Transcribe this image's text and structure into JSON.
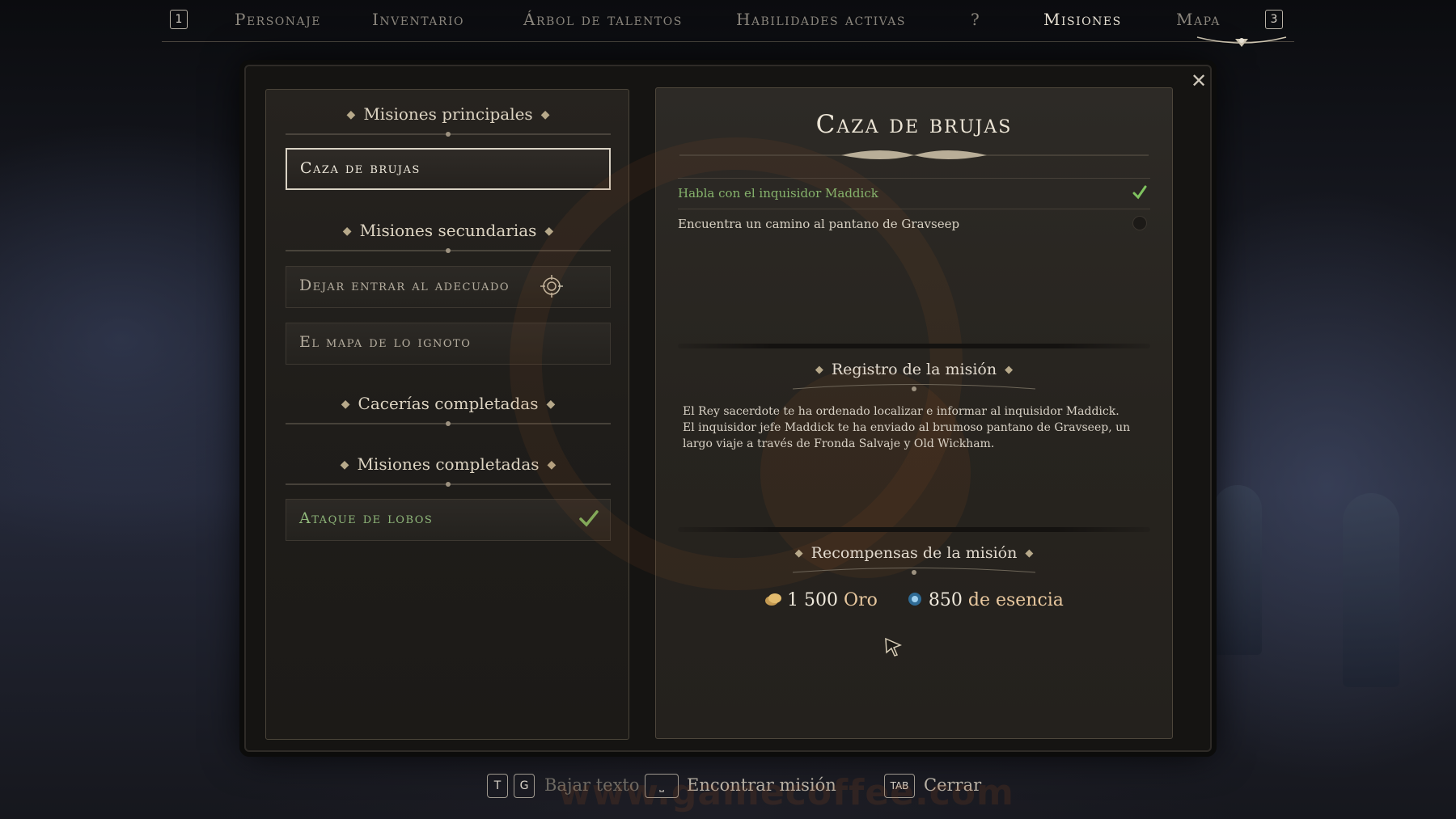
{
  "nav": {
    "left_key": "1",
    "right_key": "3",
    "tabs": [
      {
        "label": "Personaje",
        "active": false
      },
      {
        "label": "Inventario",
        "active": false
      },
      {
        "label": "Árbol de talentos",
        "active": false
      },
      {
        "label": "Habilidades activas",
        "active": false
      },
      {
        "label": "?",
        "active": false
      },
      {
        "label": "Misiones",
        "active": true
      },
      {
        "label": "Mapa",
        "active": false
      }
    ]
  },
  "quest_list": {
    "main_header": "Misiones principales",
    "main_quests": [
      {
        "label": "Caza de brujas",
        "selected": true
      }
    ],
    "side_header": "Misiones secundarias",
    "side_quests": [
      {
        "label": "Dejar entrar al adecuado",
        "tracked": true,
        "icon": "target-icon"
      },
      {
        "label": "El mapa de lo ignoto"
      }
    ],
    "hunts_header": "Cacerías completadas",
    "completed_header": "Misiones completadas",
    "completed_quests": [
      {
        "label": "Ataque de lobos",
        "icon": "check-icon"
      }
    ]
  },
  "quest_detail": {
    "title": "Caza de brujas",
    "objectives": [
      {
        "text": "Habla con el inquisidor Maddick",
        "done": true
      },
      {
        "text": "Encuentra un camino al pantano de Gravseep",
        "done": false
      }
    ],
    "log_header": "Registro de la misión",
    "log_lines": [
      "El Rey sacerdote te ha ordenado localizar e informar al inquisidor Maddick.",
      "El inquisidor jefe Maddick te ha enviado al brumoso pantano de Gravseep, un largo viaje a través de Fronda Salvaje y Old Wickham."
    ],
    "rewards_header": "Recompensas de la misión",
    "rewards": [
      {
        "amount": "1 500",
        "unit": "Oro",
        "icon": "gold-coins-icon"
      },
      {
        "amount": "850",
        "unit": "de esencia",
        "icon": "essence-orb-icon"
      }
    ]
  },
  "hints": {
    "scroll_keys": [
      "T",
      "G"
    ],
    "scroll_label": "Bajar texto",
    "find_key": "⎵",
    "find_label": "Encontrar misión",
    "close_key": "TAB",
    "close_label": "Cerrar"
  },
  "watermark": "www.gamecoffee.com",
  "colors": {
    "accent_gold": "#e7c79e",
    "completed_green": "#86b36c",
    "text_light": "#efe9dc",
    "panel_bg": "#27241f"
  }
}
